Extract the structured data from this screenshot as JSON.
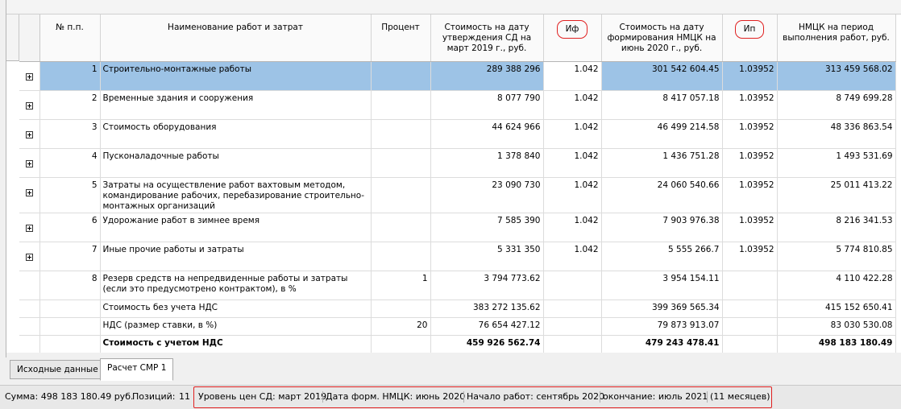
{
  "columns": {
    "num": "№ п.п.",
    "name": "Наименование работ и затрат",
    "percent": "Процент",
    "cost_sd": "Стоимость на дату утверждения СД на март 2019 г., руб.",
    "if": "Иф",
    "cost_nmck": "Стоимость на дату формирования НМЦК на июнь 2020 г., руб.",
    "ip": "Ип",
    "nmck_period": "НМЦК на период выполнения работ, руб."
  },
  "rows": [
    {
      "n": "1",
      "name": "Строительно-монтажные работы",
      "percent": "",
      "cost_sd": "289 388 296",
      "if": "1.042",
      "cost_nmck": "301 542 604.45",
      "ip": "1.03952",
      "nmck": "313 459 568.02"
    },
    {
      "n": "2",
      "name": "Временные здания и сооружения",
      "percent": "",
      "cost_sd": "8 077 790",
      "if": "1.042",
      "cost_nmck": "8 417 057.18",
      "ip": "1.03952",
      "nmck": "8 749 699.28"
    },
    {
      "n": "3",
      "name": "Стоимость оборудования",
      "percent": "",
      "cost_sd": "44 624 966",
      "if": "1.042",
      "cost_nmck": "46 499 214.58",
      "ip": "1.03952",
      "nmck": "48 336 863.54"
    },
    {
      "n": "4",
      "name": "Пусконаладочные работы",
      "percent": "",
      "cost_sd": "1 378 840",
      "if": "1.042",
      "cost_nmck": "1 436 751.28",
      "ip": "1.03952",
      "nmck": "1 493 531.69"
    },
    {
      "n": "5",
      "name": "Затраты на осуществление работ вахтовым методом, командирование рабочих, перебазирование строительно-монтажных организаций",
      "percent": "",
      "cost_sd": "23 090 730",
      "if": "1.042",
      "cost_nmck": "24 060 540.66",
      "ip": "1.03952",
      "nmck": "25 011 413.22"
    },
    {
      "n": "6",
      "name": "Удорожание работ в зимнее время",
      "percent": "",
      "cost_sd": "7 585 390",
      "if": "1.042",
      "cost_nmck": "7 903 976.38",
      "ip": "1.03952",
      "nmck": "8 216 341.53"
    },
    {
      "n": "7",
      "name": "Иные прочие работы и затраты",
      "percent": "",
      "cost_sd": "5 331 350",
      "if": "1.042",
      "cost_nmck": "5 555 266.7",
      "ip": "1.03952",
      "nmck": "5 774 810.85"
    },
    {
      "n": "8",
      "name": "Резерв средств на непредвиденные работы и затраты (если это предусмотрено контрактом), в %",
      "percent": "1",
      "cost_sd": "3 794 773.62",
      "if": "",
      "cost_nmck": "3 954 154.11",
      "ip": "",
      "nmck": "4 110 422.28"
    }
  ],
  "summary": [
    {
      "name": "Стоимость без учета НДС",
      "percent": "",
      "cost_sd": "383 272 135.62",
      "cost_nmck": "399 369 565.34",
      "nmck": "415 152 650.41"
    },
    {
      "name": "НДС (размер ставки, в %)",
      "percent": "20",
      "cost_sd": "76 654 427.12",
      "cost_nmck": "79 873 913.07",
      "nmck": "83 030 530.08"
    },
    {
      "name": "Стоимость с учетом НДС",
      "percent": "",
      "cost_sd": "459 926 562.74",
      "cost_nmck": "479 243 478.41",
      "nmck": "498 183 180.49"
    }
  ],
  "tabs": [
    {
      "label": "Исходные данные"
    },
    {
      "label": "Расчет СМР 1"
    }
  ],
  "status": {
    "sum": "Сумма: 498 183 180.49 руб.",
    "positions_label": "Позиций:",
    "positions_value": "11",
    "price_level": "Уровень цен СД: март 2019",
    "date_form": "Дата форм. НМЦК: июнь 2020",
    "start": "Начало работ: сентябрь 2020",
    "end": "окончание: июль 2021",
    "duration": "(11 месяцев)"
  },
  "colors": {
    "selection": "#9dc3e6",
    "highlight_outline": "#e02020"
  }
}
